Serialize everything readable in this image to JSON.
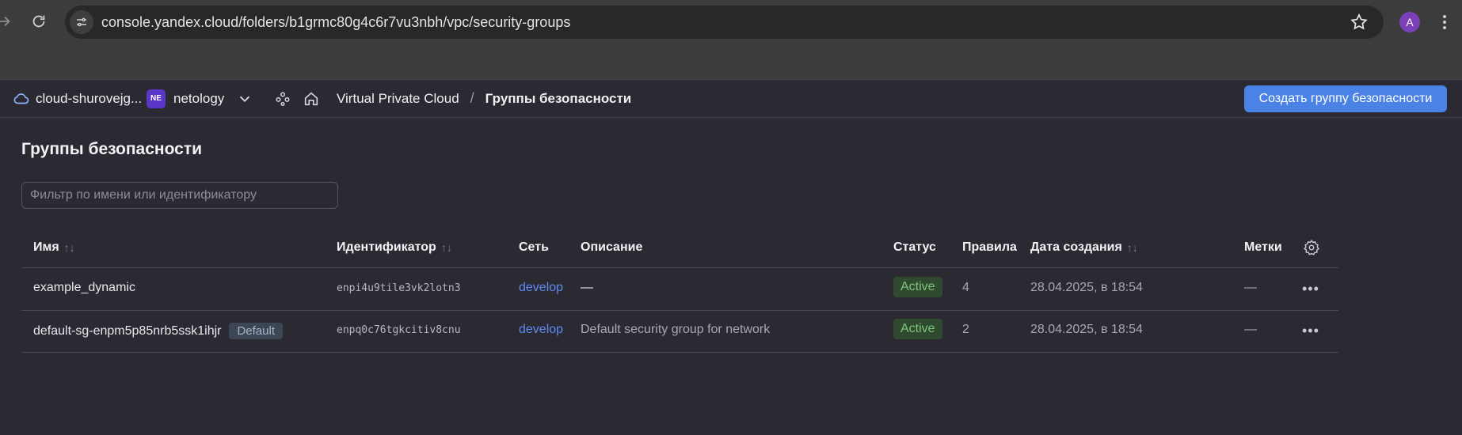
{
  "browser": {
    "url": "console.yandex.cloud/folders/b1grmc80g4c6r7vu3nbh/vpc/security-groups",
    "profile_initial": "A"
  },
  "header": {
    "cloud_name": "cloud-shurovejg...",
    "org_badge": "NE",
    "org_name": "netology",
    "breadcrumb": {
      "service": "Virtual Private Cloud",
      "separator": "/",
      "current": "Группы безопасности"
    },
    "create_button": "Создать группу безопасности"
  },
  "main": {
    "title": "Группы безопасности",
    "filter_placeholder": "Фильтр по имени или идентификатору",
    "columns": {
      "name": "Имя",
      "id": "Идентификатор",
      "network": "Сеть",
      "description": "Описание",
      "status": "Статус",
      "rules": "Правила",
      "created": "Дата создания",
      "labels": "Метки",
      "sort_glyph": "↑↓"
    },
    "rows": [
      {
        "name": "example_dynamic",
        "badge": "",
        "id": "enpi4u9tile3vk2lotn3",
        "network": "develop",
        "description": "—",
        "status": "Active",
        "rules": "4",
        "created": "28.04.2025, в 18:54",
        "labels": "—"
      },
      {
        "name": "default-sg-enpm5p85nrb5ssk1ihjr",
        "badge": "Default",
        "id": "enpq0c76tgkcitiv8cnu",
        "network": "develop",
        "description": "Default security group for network",
        "status": "Active",
        "rules": "2",
        "created": "28.04.2025, в 18:54",
        "labels": "—"
      }
    ],
    "more_glyph": "•••"
  }
}
